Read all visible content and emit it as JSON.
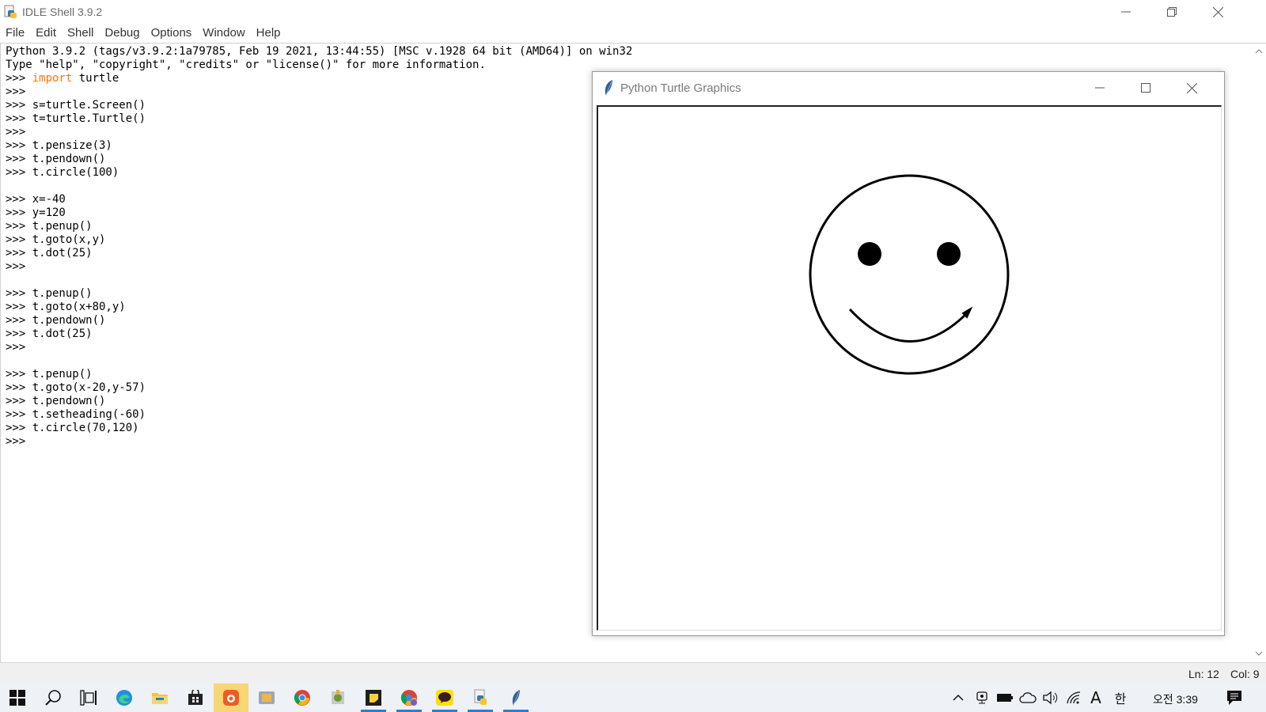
{
  "window": {
    "title": "IDLE Shell 3.9.2"
  },
  "menu": [
    "File",
    "Edit",
    "Shell",
    "Debug",
    "Options",
    "Window",
    "Help"
  ],
  "shell": {
    "lines": [
      {
        "prompt": "",
        "kw": "",
        "text": "Python 3.9.2 (tags/v3.9.2:1a79785, Feb 19 2021, 13:44:55) [MSC v.1928 64 bit (AMD64)] on win32"
      },
      {
        "prompt": "",
        "kw": "",
        "text": "Type \"help\", \"copyright\", \"credits\" or \"license()\" for more information."
      },
      {
        "prompt": ">>> ",
        "kw": "import",
        "text": " turtle"
      },
      {
        "prompt": ">>> ",
        "kw": "",
        "text": ""
      },
      {
        "prompt": ">>> ",
        "kw": "",
        "text": "s=turtle.Screen()"
      },
      {
        "prompt": ">>> ",
        "kw": "",
        "text": "t=turtle.Turtle()"
      },
      {
        "prompt": ">>> ",
        "kw": "",
        "text": ""
      },
      {
        "prompt": ">>> ",
        "kw": "",
        "text": "t.pensize(3)"
      },
      {
        "prompt": ">>> ",
        "kw": "",
        "text": "t.pendown()"
      },
      {
        "prompt": ">>> ",
        "kw": "",
        "text": "t.circle(100)"
      },
      {
        "prompt": "",
        "kw": "",
        "text": ""
      },
      {
        "prompt": ">>> ",
        "kw": "",
        "text": "x=-40"
      },
      {
        "prompt": ">>> ",
        "kw": "",
        "text": "y=120"
      },
      {
        "prompt": ">>> ",
        "kw": "",
        "text": "t.penup()"
      },
      {
        "prompt": ">>> ",
        "kw": "",
        "text": "t.goto(x,y)"
      },
      {
        "prompt": ">>> ",
        "kw": "",
        "text": "t.dot(25)"
      },
      {
        "prompt": ">>> ",
        "kw": "",
        "text": ""
      },
      {
        "prompt": "",
        "kw": "",
        "text": ""
      },
      {
        "prompt": ">>> ",
        "kw": "",
        "text": "t.penup()"
      },
      {
        "prompt": ">>> ",
        "kw": "",
        "text": "t.goto(x+80,y)"
      },
      {
        "prompt": ">>> ",
        "kw": "",
        "text": "t.pendown()"
      },
      {
        "prompt": ">>> ",
        "kw": "",
        "text": "t.dot(25)"
      },
      {
        "prompt": ">>> ",
        "kw": "",
        "text": ""
      },
      {
        "prompt": "",
        "kw": "",
        "text": ""
      },
      {
        "prompt": ">>> ",
        "kw": "",
        "text": "t.penup()"
      },
      {
        "prompt": ">>> ",
        "kw": "",
        "text": "t.goto(x-20,y-57)"
      },
      {
        "prompt": ">>> ",
        "kw": "",
        "text": "t.pendown()"
      },
      {
        "prompt": ">>> ",
        "kw": "",
        "text": "t.setheading(-60)"
      },
      {
        "prompt": ">>> ",
        "kw": "",
        "text": "t.circle(70,120)"
      },
      {
        "prompt": ">>> ",
        "kw": "",
        "text": ""
      }
    ]
  },
  "status": {
    "ln": "Ln: 12",
    "col": "Col: 9"
  },
  "turtle_window": {
    "title": "Python Turtle Graphics"
  },
  "taskbar": {
    "clock": "오전 3:39",
    "ime": "한",
    "font_indicator": "A",
    "apps": [
      "start-icon",
      "search-icon",
      "task-view-icon",
      "edge-icon",
      "file-explorer-icon",
      "store-icon",
      "app-orange-icon",
      "app-media-icon",
      "chrome-icon",
      "app-tool-icon",
      "sticky-notes-icon",
      "chrome-profile-icon",
      "kakaotalk-icon",
      "python-icon",
      "turtle-feather-icon"
    ]
  },
  "colors": {
    "keyword": "#ff7700",
    "taskbar_accent": "#2a7fd4"
  }
}
